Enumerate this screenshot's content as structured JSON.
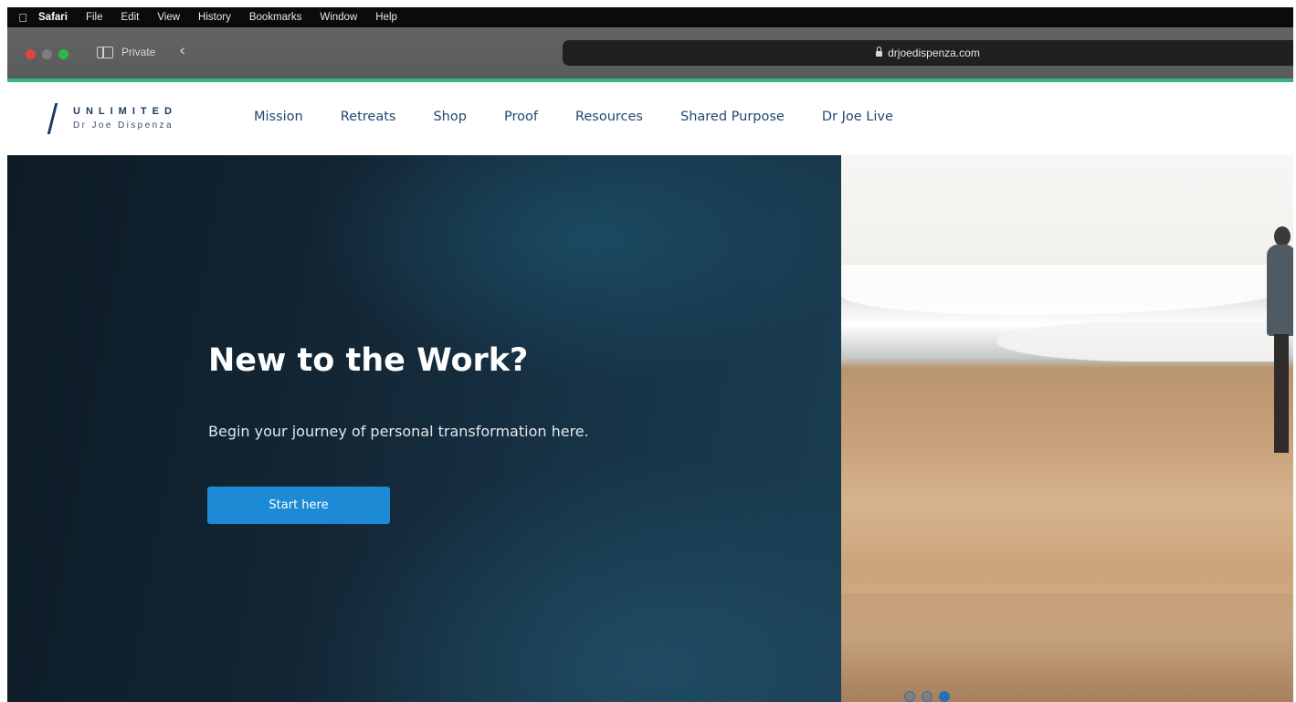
{
  "menubar": {
    "items": [
      "Safari",
      "File",
      "Edit",
      "View",
      "History",
      "Bookmarks",
      "Window",
      "Help"
    ]
  },
  "browser": {
    "private_label": "Private",
    "url": "drjoedispenza.com"
  },
  "site": {
    "logo_title": "UNLIMITED",
    "logo_subtitle": "Dr Joe Dispenza",
    "nav": [
      "Mission",
      "Retreats",
      "Shop",
      "Proof",
      "Resources",
      "Shared Purpose",
      "Dr Joe Live"
    ]
  },
  "hero": {
    "title": "New to the Work?",
    "subtitle": "Begin your journey of personal transformation here.",
    "button_label": "Start here",
    "slide_count": 3,
    "active_slide": 3
  },
  "colors": {
    "accent_line": "#37b57a",
    "button": "#1c8ad4",
    "nav_text": "#1f4873",
    "logo": "#1b3a5c"
  }
}
